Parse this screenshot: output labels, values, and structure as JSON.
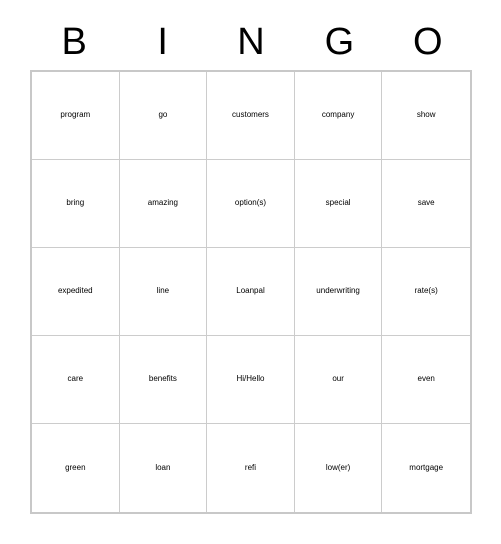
{
  "card": {
    "title": "BINGO",
    "header_letters": [
      "B",
      "I",
      "N",
      "G",
      "O"
    ],
    "colors": {
      "page_background": "#ffffff",
      "cell_background": "#ffffff",
      "text": "#000000",
      "outer_border": "#c8c8c8",
      "inner_border": "#cccccc"
    },
    "grid": {
      "columns": 5,
      "rows": 5,
      "free_space": false
    },
    "rows": [
      [
        {
          "label": "program",
          "size": "s"
        },
        {
          "label": "go",
          "size": "xxl"
        },
        {
          "label": "customers",
          "size": "xs"
        },
        {
          "label": "company",
          "size": "xs"
        },
        {
          "label": "show",
          "size": "xl"
        }
      ],
      [
        {
          "label": "bring",
          "size": "xl"
        },
        {
          "label": "amazing",
          "size": "s"
        },
        {
          "label": "option(s)",
          "size": "s"
        },
        {
          "label": "special",
          "size": "m"
        },
        {
          "label": "save",
          "size": "xl"
        }
      ],
      [
        {
          "label": "expedited",
          "size": "xs"
        },
        {
          "label": "line",
          "size": "xxl"
        },
        {
          "label": "Loanpal",
          "size": "m"
        },
        {
          "label": "underwriting",
          "size": "xxs"
        },
        {
          "label": "rate(s)",
          "size": "m"
        }
      ],
      [
        {
          "label": "care",
          "size": "xl"
        },
        {
          "label": "benefits",
          "size": "s"
        },
        {
          "label": "Hi/Hello",
          "size": "m"
        },
        {
          "label": "our",
          "size": "xxl"
        },
        {
          "label": "even",
          "size": "xl"
        }
      ],
      [
        {
          "label": "green",
          "size": "l"
        },
        {
          "label": "loan",
          "size": "xxl"
        },
        {
          "label": "refi",
          "size": "xxl"
        },
        {
          "label": "low(er)",
          "size": "m"
        },
        {
          "label": "mortgage",
          "size": "xxs"
        }
      ]
    ]
  }
}
